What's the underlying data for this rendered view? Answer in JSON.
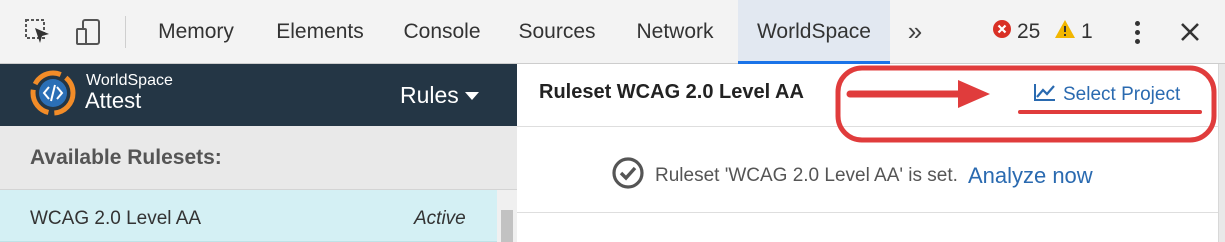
{
  "devtools": {
    "tabs": [
      {
        "label": "Memory"
      },
      {
        "label": "Elements"
      },
      {
        "label": "Console"
      },
      {
        "label": "Sources"
      },
      {
        "label": "Network"
      },
      {
        "label": "WorldSpace"
      }
    ],
    "overflow_label": "»",
    "errors_count": "25",
    "warnings_count": "1",
    "icons": [
      "inspect-element-icon",
      "device-toggle-icon",
      "error-icon",
      "warning-icon",
      "more-options-icon",
      "close-icon"
    ],
    "accent_color": "#1a73e8"
  },
  "sidebar": {
    "brand_top": "WorldSpace",
    "brand_main": "Attest",
    "rules_menu": "Rules",
    "available_label": "Available Rulesets:",
    "rulesets": [
      {
        "name": "WCAG 2.0 Level AA",
        "status": "Active"
      }
    ],
    "header_color": "#243645",
    "row_color": "#d4f0f4"
  },
  "main": {
    "ruleset_title": "Ruleset WCAG 2.0 Level AA",
    "select_project": "Select Project",
    "status_text": "Ruleset 'WCAG 2.0 Level AA' is set.",
    "analyze_link": "Analyze now",
    "link_color": "#2a6ab0"
  },
  "annotation": {
    "color": "#e03c3c"
  }
}
